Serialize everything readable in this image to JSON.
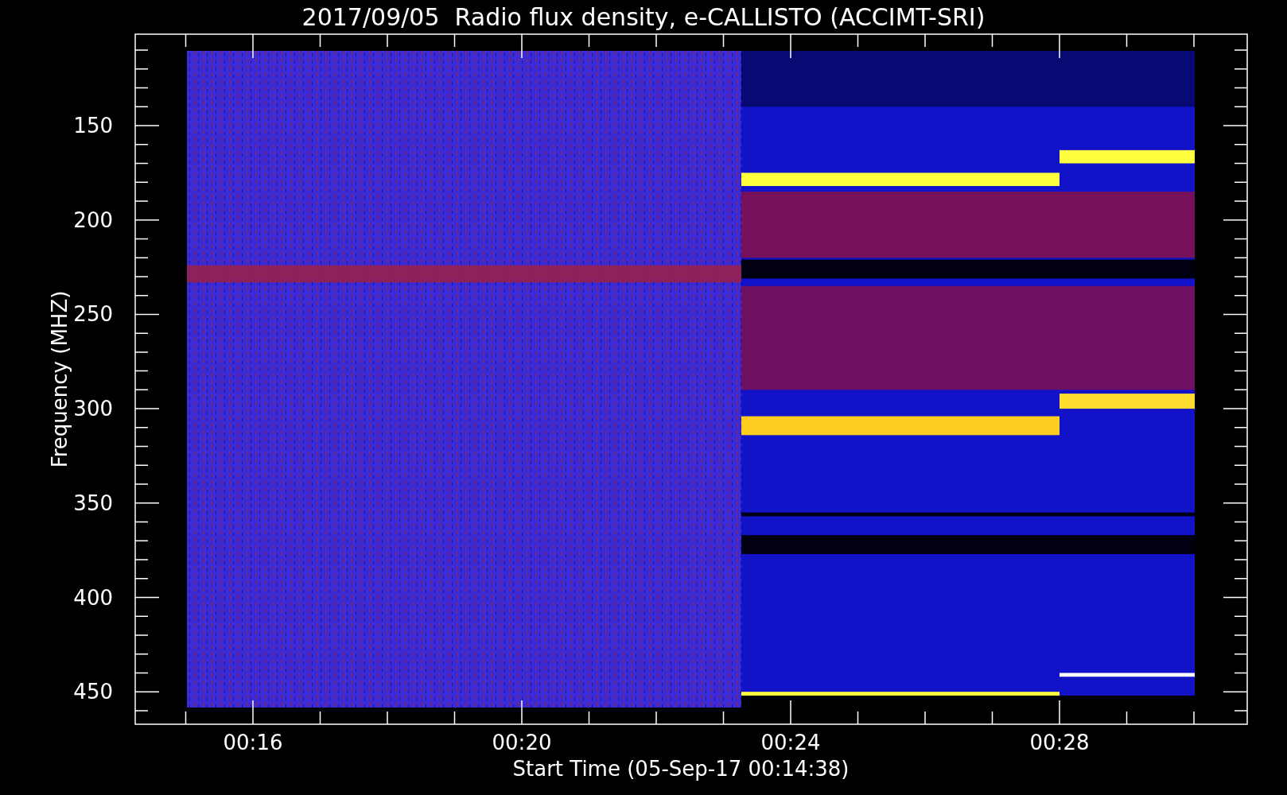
{
  "title": "2017/09/05  Radio flux density, e-CALLISTO (ACCIMT-SRI)",
  "y_axis": {
    "label": "Frequency (MHZ)",
    "ticks": [
      "150",
      "200",
      "250",
      "300",
      "350",
      "400",
      "450"
    ]
  },
  "x_axis": {
    "label": "Start Time (05-Sep-17 00:14:38)",
    "ticks": [
      "00:16",
      "00:20",
      "00:24",
      "00:28"
    ]
  }
}
